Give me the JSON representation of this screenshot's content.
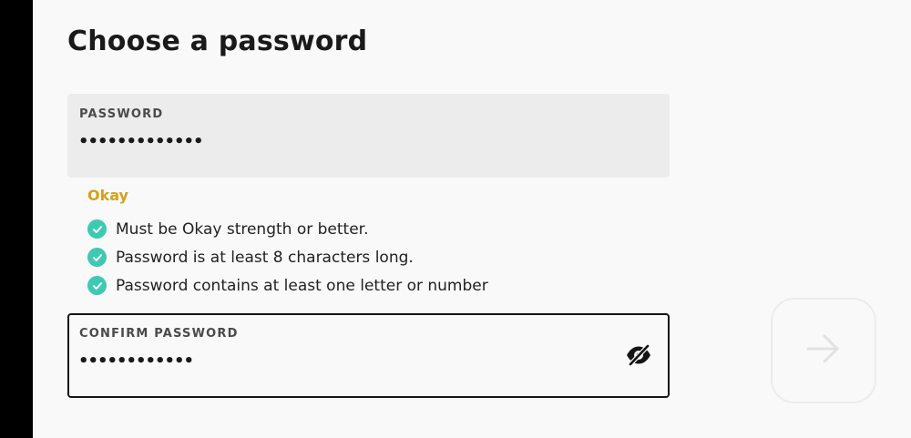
{
  "page": {
    "title": "Choose a password"
  },
  "password_field": {
    "label": "PASSWORD",
    "value": "•••••••••••••"
  },
  "strength": {
    "label": "Okay",
    "color": "#d4a21a"
  },
  "rules": [
    {
      "text": "Must be Okay strength or better.",
      "met": true
    },
    {
      "text": "Password is at least 8 characters long.",
      "met": true
    },
    {
      "text": "Password contains at least one letter or number",
      "met": true
    }
  ],
  "confirm_field": {
    "label": "CONFIRM PASSWORD",
    "value": "••••••••••••",
    "toggle_icon": "eye-slash-icon"
  },
  "next_button": {
    "icon": "arrow-right-icon",
    "enabled": false
  },
  "colors": {
    "accent_check": "#3ec9b2",
    "strength_okay": "#d4a21a"
  }
}
